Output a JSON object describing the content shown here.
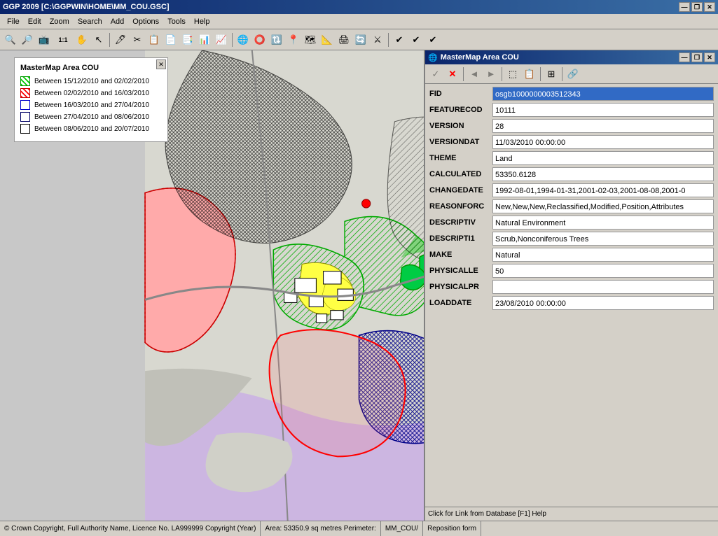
{
  "titleBar": {
    "title": "GGP 2009 [C:\\GGPWIN\\HOME\\MM_COU.GSC]",
    "minimize": "—",
    "maximize": "❐",
    "close": "✕"
  },
  "menuBar": {
    "items": [
      "File",
      "Edit",
      "Zoom",
      "Search",
      "Add",
      "Options",
      "Tools",
      "Help"
    ]
  },
  "legend": {
    "title": "MasterMap Area COU",
    "items": [
      {
        "color": "#00cc00",
        "pattern": "diagonal",
        "label": "Between 15/12/2010 and 02/02/2010"
      },
      {
        "color": "#ff0000",
        "pattern": "solid",
        "label": "Between 02/02/2010 and 16/03/2010"
      },
      {
        "color": "#0000ff",
        "pattern": "cross",
        "label": "Between 16/03/2010 and 27/04/2010"
      },
      {
        "color": "#0000aa",
        "pattern": "cross2",
        "label": "Between 27/04/2010 and 08/06/2010"
      },
      {
        "color": "#000000",
        "pattern": "crosshatch",
        "label": "Between 08/06/2010 and 20/07/2010"
      }
    ]
  },
  "attrPanel": {
    "title": "MasterMap Area COU",
    "toolbar": {
      "confirm": "✓",
      "cancel": "✕",
      "back": "◄",
      "forward": "►",
      "copy": "⧉",
      "paste": "📋",
      "multiEdit": "⊞",
      "extra": "🔗"
    },
    "fields": [
      {
        "label": "FID",
        "value": "osgb1000000003512343",
        "selected": true
      },
      {
        "label": "FEATURECOD",
        "value": "     10111",
        "selected": false
      },
      {
        "label": "VERSION",
        "value": "        28",
        "selected": false
      },
      {
        "label": "VERSIONDAT",
        "value": "11/03/2010 00:00:00",
        "selected": false
      },
      {
        "label": "THEME",
        "value": "Land",
        "selected": false
      },
      {
        "label": "CALCULATED",
        "value": "     53350.6128",
        "selected": false
      },
      {
        "label": "CHANGEDATE",
        "value": "1992-08-01,1994-01-31,2001-02-03,2001-08-08,2001-0",
        "selected": false
      },
      {
        "label": "REASONFORC",
        "value": "New,New,New,Reclassified,Modified,Position,Attributes",
        "selected": false
      },
      {
        "label": "DESCRIPTIV",
        "value": "Natural Environment",
        "selected": false
      },
      {
        "label": "DESCRIPTI1",
        "value": "Scrub,Nonconiferous Trees",
        "selected": false
      },
      {
        "label": "MAKE",
        "value": "Natural",
        "selected": false
      },
      {
        "label": "PHYSICALLE",
        "value": "  50",
        "selected": false
      },
      {
        "label": "PHYSICALPR",
        "value": "",
        "selected": false
      },
      {
        "label": "LOADDATE",
        "value": "23/08/2010 00:00:00",
        "selected": false
      }
    ],
    "status": "Click for Link from Database  [F1] Help"
  },
  "statusBar": {
    "copyright": "© Crown Copyright, Full Authority Name, Licence No. LA999999 Copyright (Year)",
    "area": "Area: 53350.9 sq metres  Perimeter:",
    "tab": "MM_COU",
    "reposition": "Reposition form"
  }
}
